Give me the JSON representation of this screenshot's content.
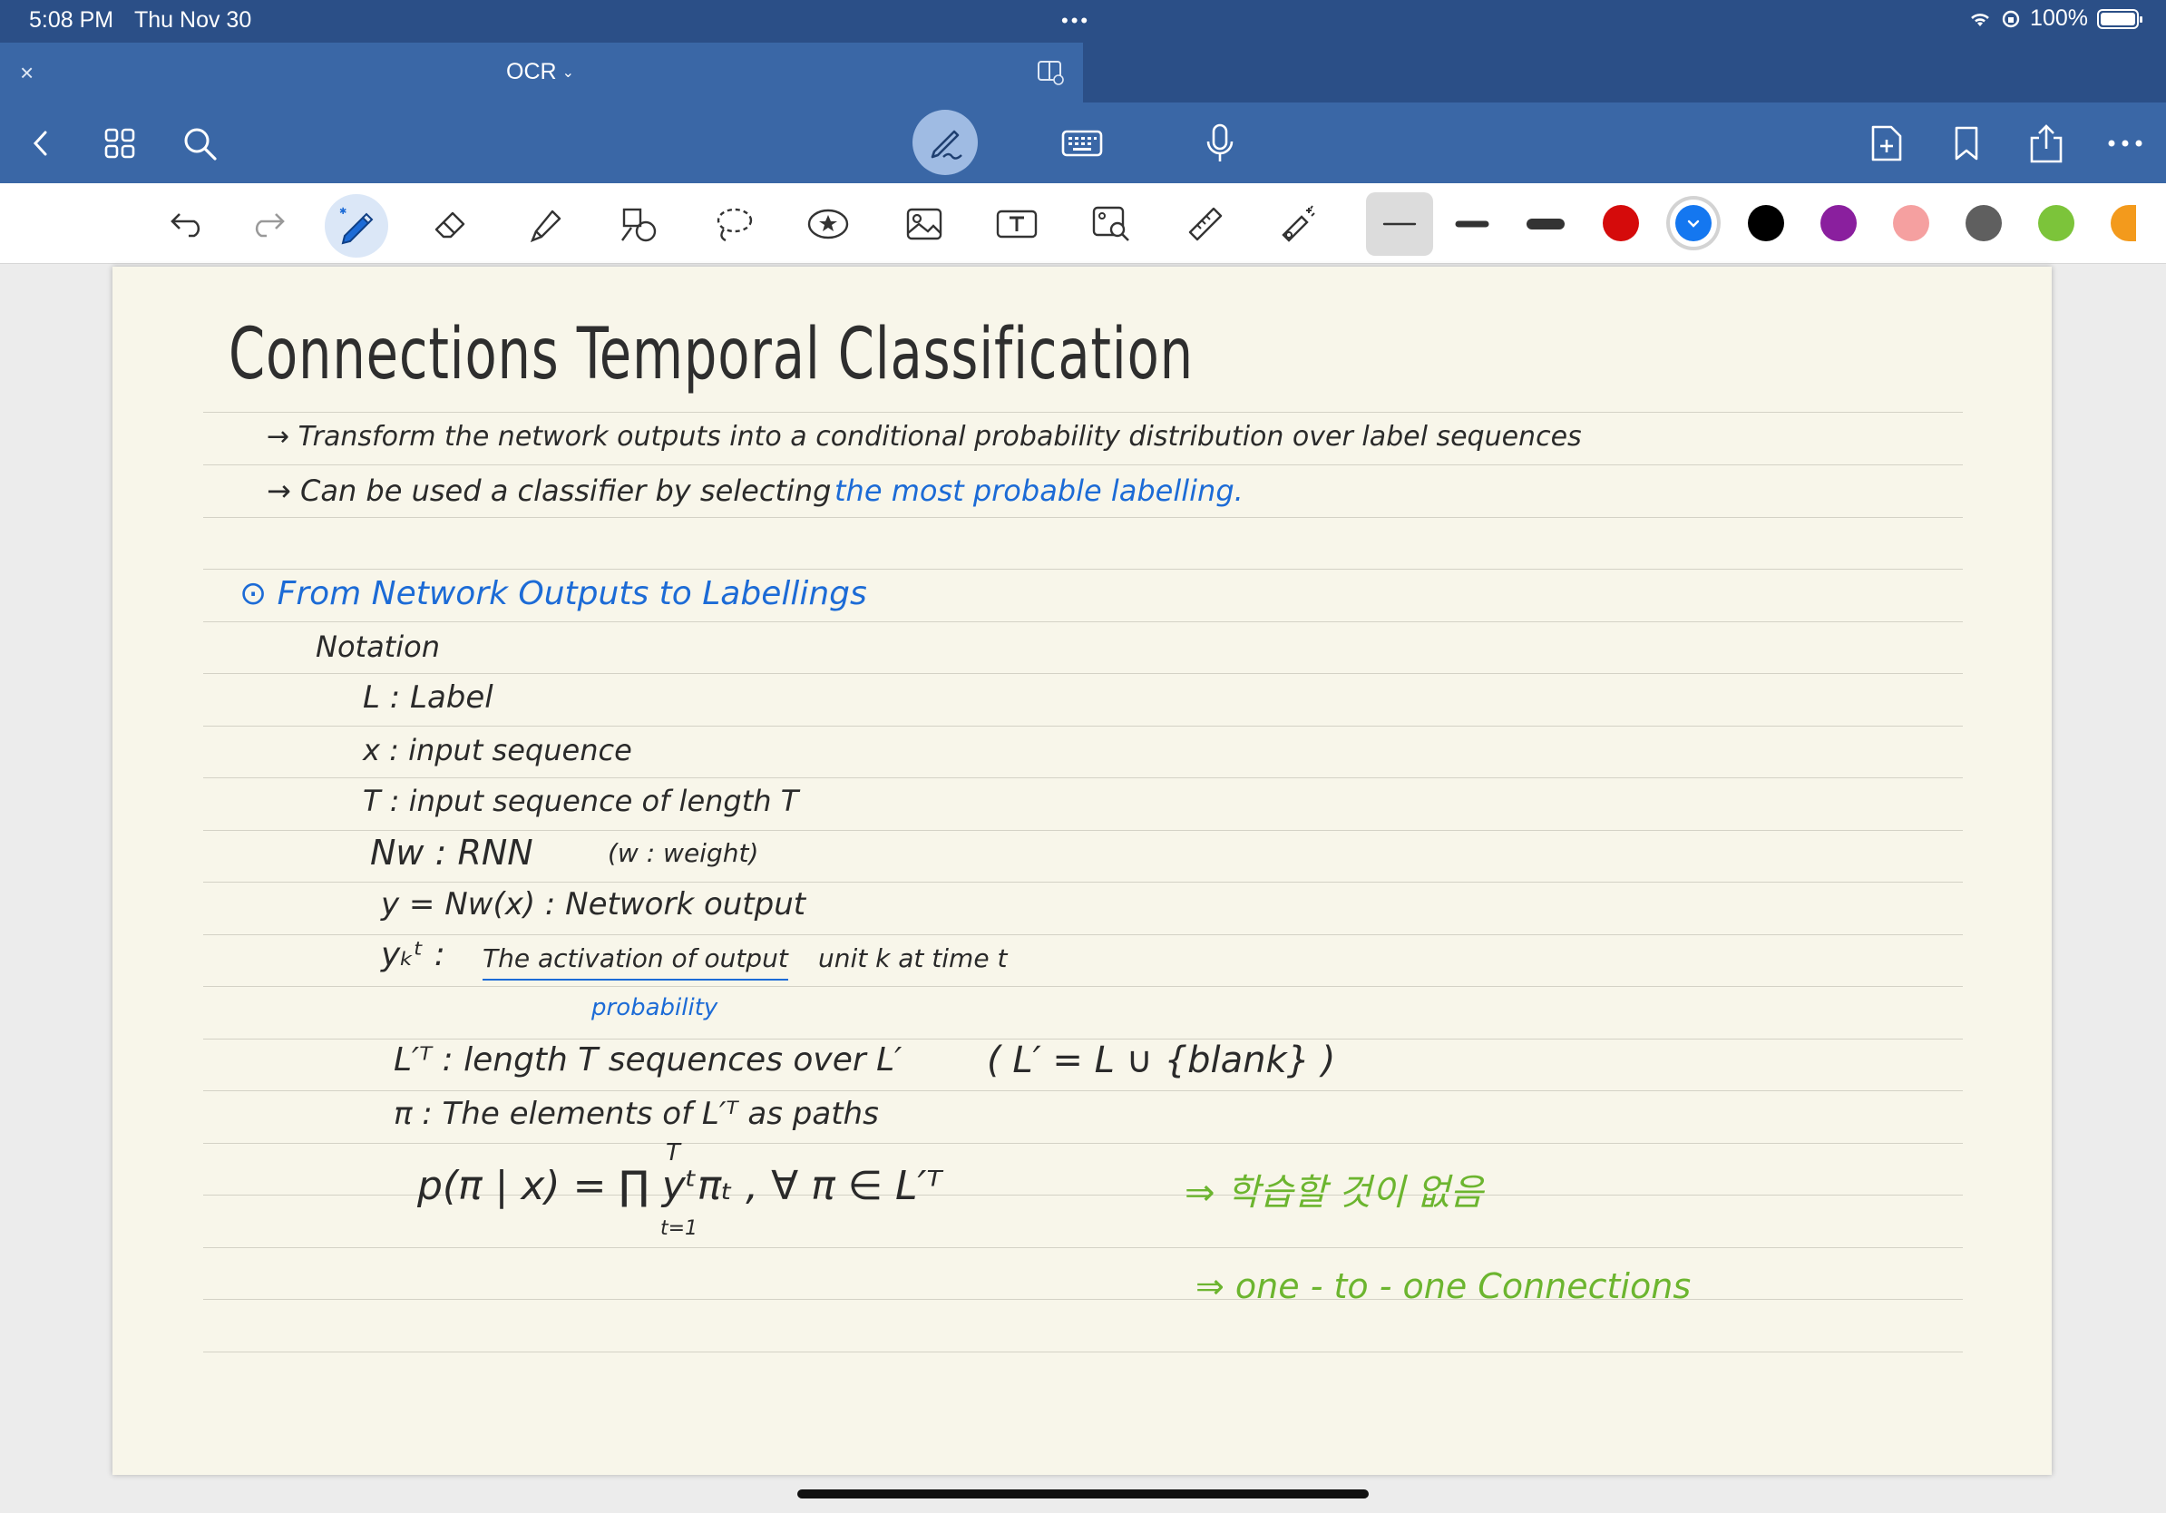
{
  "status": {
    "time": "5:08 PM",
    "date": "Thu Nov 30",
    "dots": "•••",
    "battery": "100%"
  },
  "tab": {
    "title": "OCR",
    "close": "×"
  },
  "colors": {
    "palette": [
      "#d50b0b",
      "#1477f0",
      "#000000",
      "#8a1f9e",
      "#f5a0a0",
      "#5f5f5f",
      "#7cc43a",
      "#f39a1c"
    ],
    "selected": "#1477f0"
  },
  "note": {
    "title": "Connections Temporal Classification",
    "bullet1_a": "→ Transform the network outputs into a conditional probability distribution over label sequences",
    "bullet2_a": "→ Can be used a classifier by selecting",
    "bullet2_b": "the most probable labelling.",
    "section": "⊙ From Network Outputs to Labellings",
    "notation": "Notation",
    "def_L": "L : Label",
    "def_x": "x : input sequence",
    "def_T": "T : input sequence of length T",
    "def_N_a": "Nw : RNN",
    "def_N_b": "(w : weight)",
    "def_y": "y = Nw(x)  :  Network output",
    "def_yk_sym": "yₖᵗ :",
    "def_yk_u": "The activation of output",
    "def_yk_b": "unit k at time t",
    "probability": "probability",
    "def_LT_a": "L′ᵀ : length T sequences over L′",
    "def_LT_b": "( L′ = L ∪ {blank} )",
    "def_pi": "π  :  The elements of L′ᵀ as paths",
    "formula": "p(π | x) = ∏ yᵗπₜ ,  ∀ π ∈ L′ᵀ",
    "formula_top": "T",
    "formula_bot": "t=1",
    "kr": "⇒ 학습할 것이 없음",
    "one2one": "⇒ one - to - one  Connections"
  }
}
